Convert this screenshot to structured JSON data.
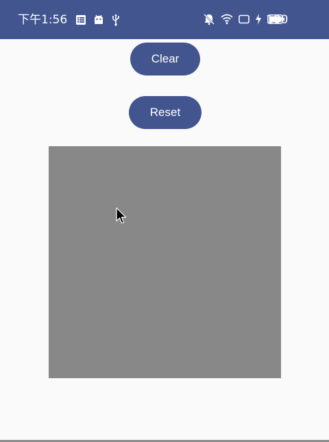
{
  "status_bar": {
    "time": "下午1:56",
    "battery": "100",
    "background_color": "#43558f"
  },
  "buttons": {
    "clear_label": "Clear",
    "reset_label": "Reset",
    "color": "#43558f"
  },
  "canvas": {
    "background_color": "#888888"
  },
  "icons": {
    "left": [
      "notes-icon",
      "android-icon",
      "usb-icon"
    ],
    "right": [
      "mute-icon",
      "wifi-icon",
      "screen-icon",
      "charging-icon",
      "battery-icon"
    ]
  }
}
